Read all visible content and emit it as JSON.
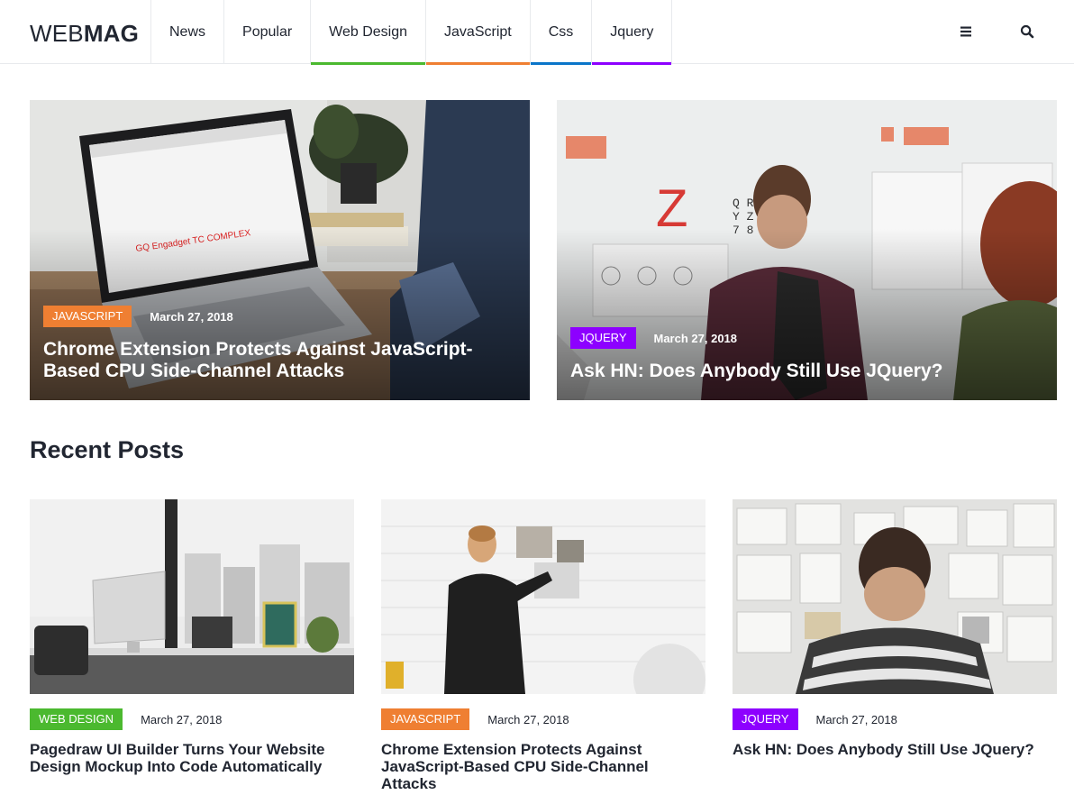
{
  "header": {
    "logo_thin": "WEB",
    "logo_bold": "MAG",
    "nav": [
      {
        "label": "News",
        "color": ""
      },
      {
        "label": "Popular",
        "color": ""
      },
      {
        "label": "Web Design",
        "color": "#4bb92f"
      },
      {
        "label": "JavaScript",
        "color": "#ef7f32"
      },
      {
        "label": "Css",
        "color": "#0a75c9"
      },
      {
        "label": "Jquery",
        "color": "#8d00ff"
      }
    ],
    "menu_icon": "menu-icon",
    "search_icon": "search-icon"
  },
  "featured": [
    {
      "category": "JAVASCRIPT",
      "category_color": "#ef7f32",
      "date": "March 27, 2018",
      "title": "Chrome Extension Protects Against JavaScript-Based CPU Side-Channel Attacks"
    },
    {
      "category": "JQUERY",
      "category_color": "#8d00ff",
      "date": "March 27, 2018",
      "title": "Ask HN: Does Anybody Still Use JQuery?"
    }
  ],
  "recent": {
    "title": "Recent Posts",
    "posts": [
      {
        "category": "WEB DESIGN",
        "category_color": "#4bb92f",
        "date": "March 27, 2018",
        "title": "Pagedraw UI Builder Turns Your Website Design Mockup Into Code Automatically"
      },
      {
        "category": "JAVASCRIPT",
        "category_color": "#ef7f32",
        "date": "March 27, 2018",
        "title": "Chrome Extension Protects Against JavaScript-Based CPU Side-Channel Attacks"
      },
      {
        "category": "JQUERY",
        "category_color": "#8d00ff",
        "date": "March 27, 2018",
        "title": "Ask HN: Does Anybody Still Use JQuery?"
      }
    ]
  }
}
